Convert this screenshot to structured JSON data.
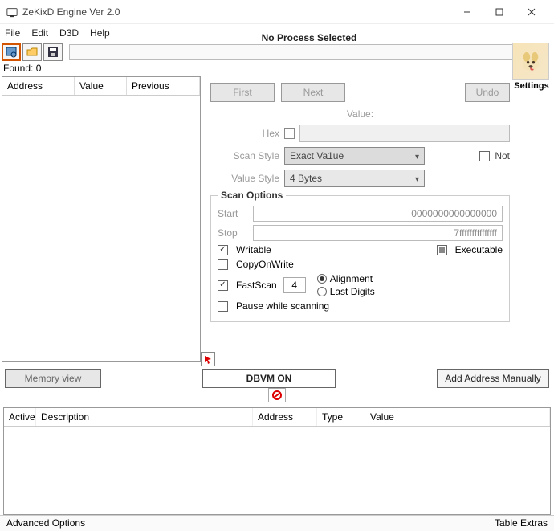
{
  "window": {
    "title": "ZeKixD Engine Ver 2.0"
  },
  "menu": {
    "file": "File",
    "edit": "Edit",
    "d3d": "D3D",
    "help": "Help"
  },
  "process": {
    "label": "No Process Selected"
  },
  "avatar": {
    "caption": "Settings"
  },
  "found": {
    "text": "Found: 0"
  },
  "list": {
    "col_address": "Address",
    "col_value": "Value",
    "col_previous": "Previous"
  },
  "scan": {
    "first": "First",
    "next": "Next",
    "undo": "Undo",
    "value_label": "Value:",
    "hex_label": "Hex",
    "scan_style_label": "Scan Style",
    "scan_style_value": "Exact Va1ue",
    "not_label": "Not",
    "value_style_label": "Value Style",
    "value_style_value": "4 Bytes"
  },
  "options": {
    "title": "Scan Options",
    "start_label": "Start",
    "start_value": "0000000000000000",
    "stop_label": "Stop",
    "stop_value": "7fffffffffffffff",
    "writable": "Writable",
    "executable": "Executable",
    "copyonwrite": "CopyOnWrite",
    "fastscan": "FastScan",
    "fastscan_value": "4",
    "alignment": "Alignment",
    "lastdigits": "Last Digits",
    "pause": "Pause while scanning"
  },
  "buttons": {
    "memory_view": "Memory view",
    "dbvm": "DBVM ON",
    "add_manual": "Add Address Manually"
  },
  "table2": {
    "active": "Active",
    "description": "Description",
    "address": "Address",
    "type": "Type",
    "value": "Value"
  },
  "bottom": {
    "advanced": "Advanced Options",
    "extras": "Table Extras"
  }
}
